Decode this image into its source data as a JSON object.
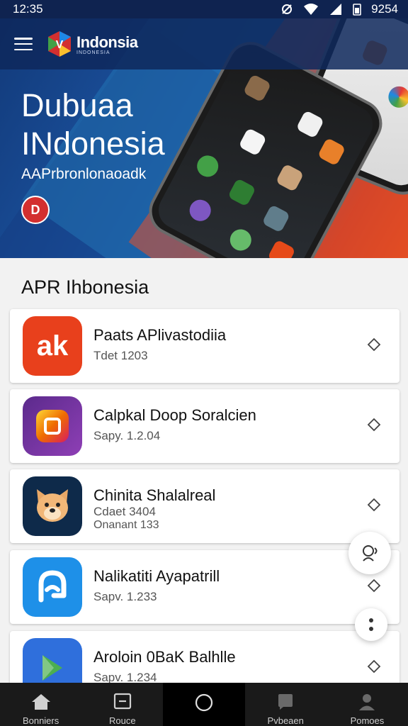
{
  "status_bar": {
    "time": "12:35",
    "battery": "9254"
  },
  "app": {
    "logo_name": "Indonsia",
    "logo_sub": "INDONESIA"
  },
  "hero": {
    "title_line1": "Dubuaa",
    "title_line2": "INdonesia",
    "subtitle": "AAPrbronlonaoadk",
    "badge_letter": "D"
  },
  "section": {
    "title": "APR Ihbonesia"
  },
  "apps": [
    {
      "name": "Paats APlivastodiia",
      "meta": "Tdet 1203",
      "meta2": "",
      "icon_text": "ak",
      "icon": "ak-logo-icon",
      "color": "#e8401c"
    },
    {
      "name": "Calpkal Doop Soralcien",
      "meta": "Sapy. 1.2.04",
      "meta2": "",
      "icon_text": "",
      "icon": "gradient-square-app-icon",
      "color": "#7b2ea0"
    },
    {
      "name": "Chinita Shalalreal",
      "meta": "Cdaet 3404",
      "meta2": "Onanant 133",
      "icon_text": "",
      "icon": "dog-face-app-icon",
      "color": "#0e2a4a"
    },
    {
      "name": "Nalikatiti Ayapatrill",
      "meta": "Sapv. 1.233",
      "meta2": "",
      "icon_text": "",
      "icon": "speech-bubble-app-icon",
      "color": "#1e90e8"
    },
    {
      "name": "Aroloin 0BaK Balhlle",
      "meta": "Sapv. 1.234",
      "meta2": "",
      "icon_text": "",
      "icon": "map-arrow-app-icon",
      "color": "#2f6fdc"
    }
  ],
  "bottom_nav": [
    {
      "label": "Bonniers",
      "icon": "home-icon"
    },
    {
      "label": "Rouce",
      "icon": "square-list-icon"
    },
    {
      "label": "",
      "icon": "circle-home-icon"
    },
    {
      "label": "Pvbeaen",
      "icon": "chat-bubble-icon"
    },
    {
      "label": "Pomoes",
      "icon": "person-icon"
    }
  ],
  "colors": {
    "status_bar": "#0f2350",
    "hero_blue": "#1a4f9a",
    "hero_red": "#e04a1f",
    "nav_bg": "#1a1a1a"
  }
}
